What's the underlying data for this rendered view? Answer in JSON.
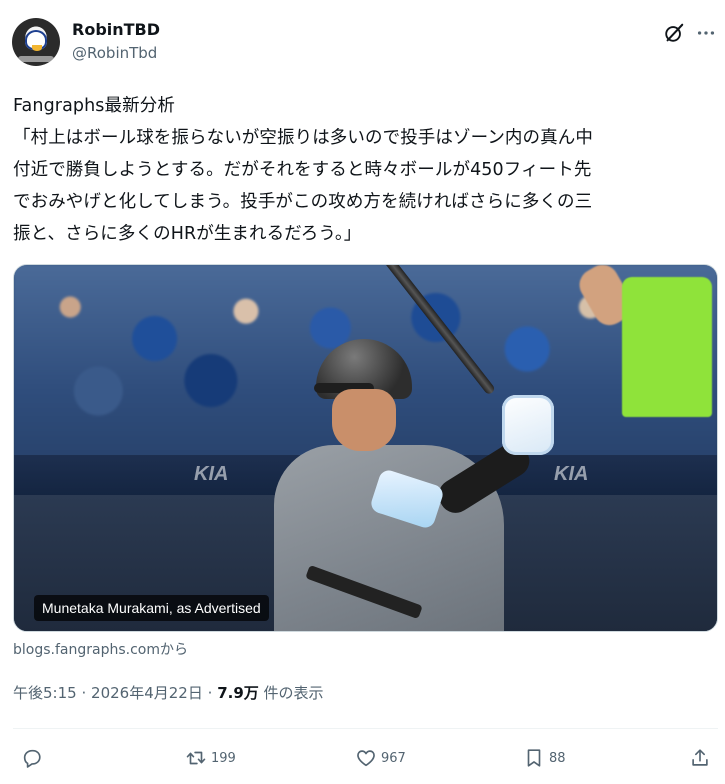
{
  "author": {
    "display_name": "RobinTBD",
    "handle": "@RobinTbd"
  },
  "tweet": {
    "lines": [
      "Fangraphs最新分析",
      "「村上はボール球を振らないが空振りは多いので投手はゾーン内の真ん中",
      "付近で勝負しようとする。だがそれをすると時々ボールが450フィート先",
      "でおみやげと化してしまう。投手がこの攻め方を続ければさらに多くの三",
      "振と、さらに多くのHRが生まれるだろう。」"
    ]
  },
  "media": {
    "caption": "Munetaka Murakami, as Advertised"
  },
  "source": "blogs.fangraphs.comから",
  "meta": {
    "time": "午後5:15",
    "separator": "·",
    "date": "2026年4月22日",
    "views": "7.9万",
    "views_label": "件の表示"
  },
  "actions": {
    "retweets": "199",
    "likes": "967",
    "bookmarks": "88"
  },
  "icons": {
    "reply": "reply-icon",
    "retweet": "retweet-icon",
    "like": "heart-icon",
    "bookmark": "bookmark-icon",
    "share": "share-icon",
    "grok": "grok-icon",
    "more": "more-icon"
  },
  "colors": {
    "text": "#0f1419",
    "muted": "#536471",
    "caption_bg": "#000000"
  }
}
